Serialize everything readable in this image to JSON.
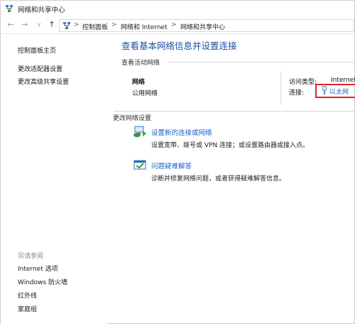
{
  "window": {
    "title": "网络和共享中心"
  },
  "address_bar": {
    "crumbs": [
      "控制面板",
      "网络和 Internet",
      "网络和共享中心"
    ],
    "separator": ">"
  },
  "nav": {
    "back": "←",
    "forward": "→",
    "dropdown": "∨",
    "up": "↑"
  },
  "sidebar": {
    "items": [
      {
        "label": "控制面板主页"
      },
      {
        "label": "更改适配器设置"
      },
      {
        "label": "更改高级共享设置"
      }
    ],
    "see_also_caption": "另请参阅",
    "see_also": [
      {
        "label": "Internet 选项"
      },
      {
        "label": "Windows 防火墙"
      },
      {
        "label": "红外线"
      },
      {
        "label": "家庭组"
      }
    ]
  },
  "main": {
    "heading": "查看基本网络信息并设置连接",
    "active_networks_label": "查看活动网络",
    "network": {
      "name": "网络",
      "type": "公用网络",
      "access_type_label": "访问类型:",
      "access_type_value": "Internet",
      "connections_label": "连接:",
      "connection_value": "以太网"
    },
    "change_settings_label": "更改网络设置",
    "tasks": [
      {
        "title": "设置新的连接或网络",
        "desc": "设置宽带、拨号或 VPN 连接；或设置路由器或接入点。",
        "icon": "network-setup-icon"
      },
      {
        "title": "问题疑难解答",
        "desc": "诊断并修复网络问题，或者获得疑难解答信息。",
        "icon": "troubleshoot-icon"
      }
    ]
  },
  "colors": {
    "link": "#1b61c9",
    "heading": "#1b4e9e",
    "highlight_border": "#e02424"
  }
}
